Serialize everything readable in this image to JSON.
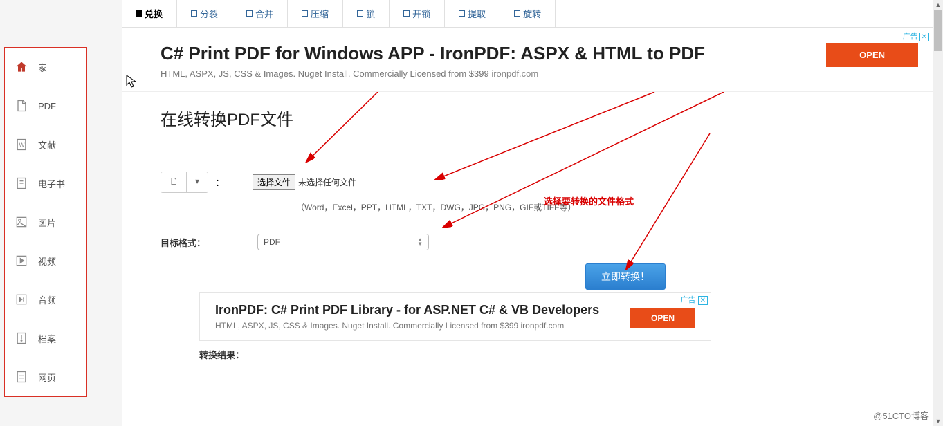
{
  "sidebar": {
    "items": [
      {
        "label": "家"
      },
      {
        "label": "PDF"
      },
      {
        "label": "文献"
      },
      {
        "label": "电子书"
      },
      {
        "label": "图片"
      },
      {
        "label": "视频"
      },
      {
        "label": "音频"
      },
      {
        "label": "档案"
      },
      {
        "label": "网页"
      }
    ]
  },
  "tabs": [
    {
      "label": "兑换",
      "active": true
    },
    {
      "label": "分裂"
    },
    {
      "label": "合并"
    },
    {
      "label": "压缩"
    },
    {
      "label": "锁"
    },
    {
      "label": "开锁"
    },
    {
      "label": "提取"
    },
    {
      "label": "旋转"
    }
  ],
  "ad_top": {
    "title": "C# Print PDF for Windows APP - IronPDF: ASPX & HTML to PDF",
    "subtitle": "HTML, ASPX, JS, CSS & Images. Nuget Install. Commercially Licensed from $399",
    "domain": "ironpdf.com",
    "button": "OPEN",
    "badge": "广告"
  },
  "page": {
    "title": "在线转换PDF文件",
    "choose_button": "选择文件",
    "no_file": "未选择任何文件",
    "hint": "（Word，Excel，PPT，HTML，TXT，DWG，JPG，PNG，GIF或TIFF等）",
    "format_label": "目标格式：",
    "format_value": "PDF",
    "convert_button": "立即转换！",
    "result_label": "转换结果："
  },
  "annotation": "选择要转换的文件格式",
  "ad_bottom": {
    "title": "IronPDF: C# Print PDF Library - for ASP.NET C# & VB Developers",
    "subtitle": "HTML, ASPX, JS, CSS & Images. Nuget Install. Commercially Licensed from $399",
    "domain": "ironpdf.com",
    "button": "OPEN",
    "badge": "广告"
  },
  "watermark": "@51CTO博客"
}
